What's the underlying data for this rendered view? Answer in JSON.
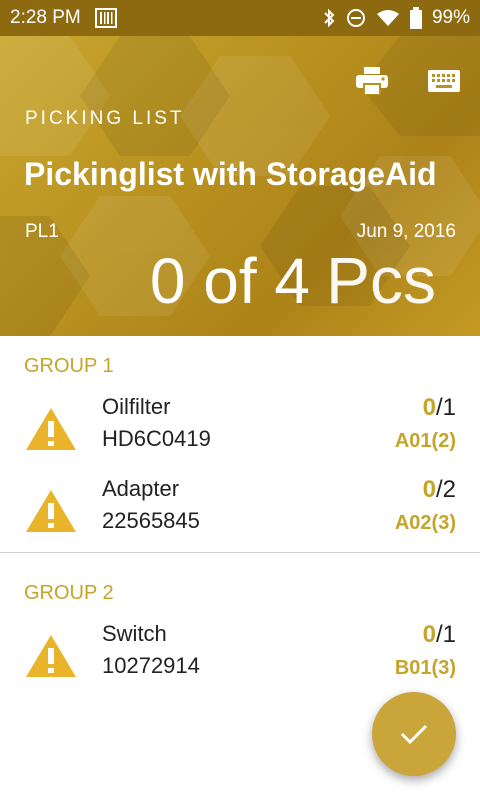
{
  "status_bar": {
    "time": "2:28 PM",
    "battery": "99%"
  },
  "header": {
    "section_label": "PICKING LIST",
    "title": "Pickinglist with StorageAid",
    "id": "PL1",
    "date": "Jun 9, 2016",
    "counter": "0 of 4",
    "unit": "Pcs",
    "colors": {
      "accent": "#c5a42a",
      "header_dark": "#8d6a10"
    }
  },
  "groups": [
    {
      "title": "GROUP 1",
      "items": [
        {
          "name": "Oilfilter",
          "code": "HD6C0419",
          "picked": "0",
          "total": "/1",
          "location": "A01(2)"
        },
        {
          "name": "Adapter",
          "code": "22565845",
          "picked": "0",
          "total": "/2",
          "location": "A02(3)"
        }
      ]
    },
    {
      "title": "GROUP 2",
      "items": [
        {
          "name": "Switch",
          "code": "10272914",
          "picked": "0",
          "total": "/1",
          "location": "B01(3)"
        }
      ]
    }
  ],
  "icons": [
    "print-icon",
    "keyboard-icon",
    "warning-icon",
    "check-icon"
  ]
}
